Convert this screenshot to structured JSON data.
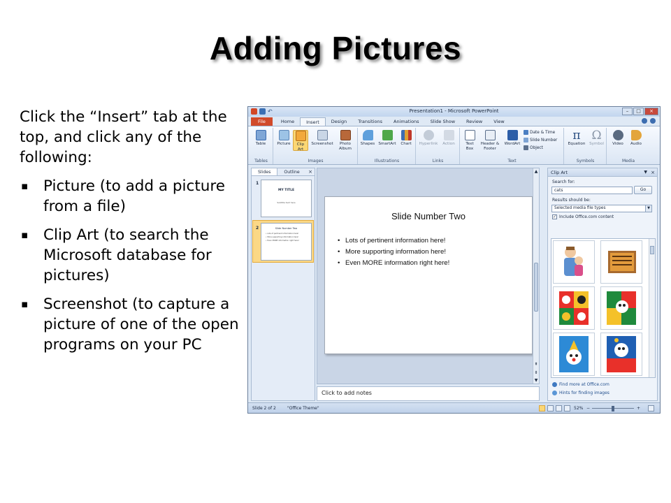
{
  "slide": {
    "title": "Adding Pictures",
    "intro": "Click the “Insert” tab at the top, and click any of the following:",
    "bullets": [
      "Picture (to add a picture from a file)",
      "Clip Art (to search the Microsoft database for pictures)",
      "Screenshot (to capture a picture of one of the open programs on your PC"
    ],
    "bullet_glyph": "▪"
  },
  "ppt": {
    "window_title": "Presentation1 - Microsoft PowerPoint",
    "tabs": [
      "File",
      "Home",
      "Insert",
      "Design",
      "Transitions",
      "Animations",
      "Slide Show",
      "Review",
      "View"
    ],
    "active_tab": "Insert",
    "ribbon": {
      "tables": {
        "label": "Tables",
        "table": "Table"
      },
      "images": {
        "label": "Images",
        "picture": "Picture",
        "clip_art": "Clip Art",
        "screenshot": "Screenshot",
        "photo_album": "Photo Album"
      },
      "illustrations": {
        "label": "Illustrations",
        "shapes": "Shapes",
        "smartart": "SmartArt",
        "chart": "Chart"
      },
      "links": {
        "label": "Links",
        "hyperlink": "Hyperlink",
        "action": "Action"
      },
      "text": {
        "label": "Text",
        "text_box": "Text Box",
        "header_footer": "Header & Footer",
        "wordart": "WordArt",
        "date_time": "Date & Time",
        "slide_number": "Slide Number",
        "object": "Object"
      },
      "symbols": {
        "label": "Symbols",
        "equation": "Equation",
        "symbol": "Symbol",
        "pi_glyph": "π",
        "omega_glyph": "Ω"
      },
      "media": {
        "label": "Media",
        "video": "Video",
        "audio": "Audio"
      }
    },
    "left_panel": {
      "tab_slides": "Slides",
      "tab_outline": "Outline",
      "close": "×",
      "thumb1": {
        "num": "1",
        "title": "MY TITLE",
        "subtitle": "Subtitle text here"
      },
      "thumb2": {
        "num": "2",
        "title": "Slide Number Two",
        "lines": [
          "• Lots of pertinent information here!",
          "• More supporting information here!",
          "• Even MORE information right here!"
        ]
      }
    },
    "slide_canvas": {
      "title": "Slide Number Two",
      "bullets": [
        "Lots of pertinent information here!",
        "More supporting information here!",
        "Even MORE information right here!"
      ]
    },
    "notes_placeholder": "Click to add notes",
    "clip_art_pane": {
      "title": "Clip Art",
      "search_label": "Search for:",
      "search_value": "cats",
      "go_label": "Go",
      "results_label": "Results should be:",
      "results_value": "Selected media file types",
      "include_office": "Include Office.com content",
      "include_checked": "✓",
      "find_more": "Find more at Office.com",
      "hints": "Hints for finding images"
    },
    "status": {
      "slide_of": "Slide 2 of 2",
      "theme": "\"Office Theme\"",
      "zoom": "52%",
      "zoom_minus": "−",
      "zoom_plus": "+"
    }
  },
  "colors": {
    "file_tab": "#d14a2a",
    "ribbon_selected": "#fbd774",
    "accent": "#3d6db0"
  }
}
